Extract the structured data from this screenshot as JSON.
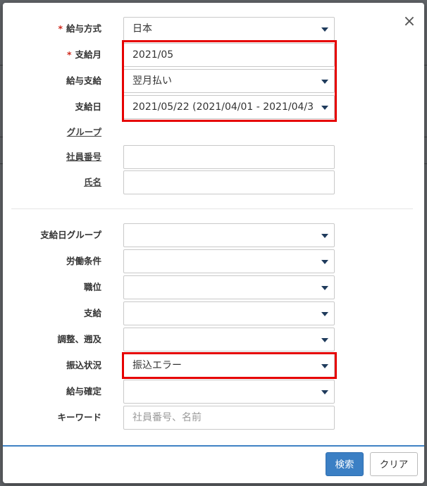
{
  "dialog": {
    "close_label": "×"
  },
  "filters_top": [
    {
      "key": "payroll_method",
      "label": "給与方式",
      "required": "*",
      "value": "日本",
      "dropdown": true,
      "link": false
    },
    {
      "key": "pay_month",
      "label": "支給月",
      "required": "*",
      "value": "2021/05",
      "dropdown": false,
      "link": false
    },
    {
      "key": "payment",
      "label": "給与支給",
      "required": "",
      "value": "翌月払い",
      "dropdown": true,
      "link": false
    },
    {
      "key": "pay_date",
      "label": "支給日",
      "required": "",
      "value": "2021/05/22 (2021/04/01 - 2021/04/3",
      "dropdown": true,
      "link": false
    },
    {
      "key": "group",
      "label": "グループ",
      "required": "",
      "value": null,
      "dropdown": false,
      "link": true
    },
    {
      "key": "employee_no",
      "label": "社員番号",
      "required": "",
      "value": "",
      "dropdown": false,
      "link": true
    },
    {
      "key": "name",
      "label": "氏名",
      "required": "",
      "value": "",
      "dropdown": false,
      "link": true
    }
  ],
  "filters_bottom": [
    {
      "key": "pay_date_group",
      "label": "支給日グループ",
      "value": ""
    },
    {
      "key": "labor_conditions",
      "label": "労働条件",
      "value": ""
    },
    {
      "key": "position",
      "label": "職位",
      "value": ""
    },
    {
      "key": "payment_item",
      "label": "支給",
      "value": ""
    },
    {
      "key": "adjustment",
      "label": "調整、遡及",
      "value": ""
    },
    {
      "key": "transfer_status",
      "label": "振込状況",
      "value": "振込エラー"
    },
    {
      "key": "payroll_confirmed",
      "label": "給与確定",
      "value": ""
    }
  ],
  "keyword": {
    "label": "キーワード",
    "placeholder": "社員番号、名前"
  },
  "buttons": {
    "search": "検索",
    "clear": "クリア"
  },
  "colors": {
    "highlight": "#e60000",
    "primary": "#3b7fc4",
    "required": "#d02b1f"
  }
}
